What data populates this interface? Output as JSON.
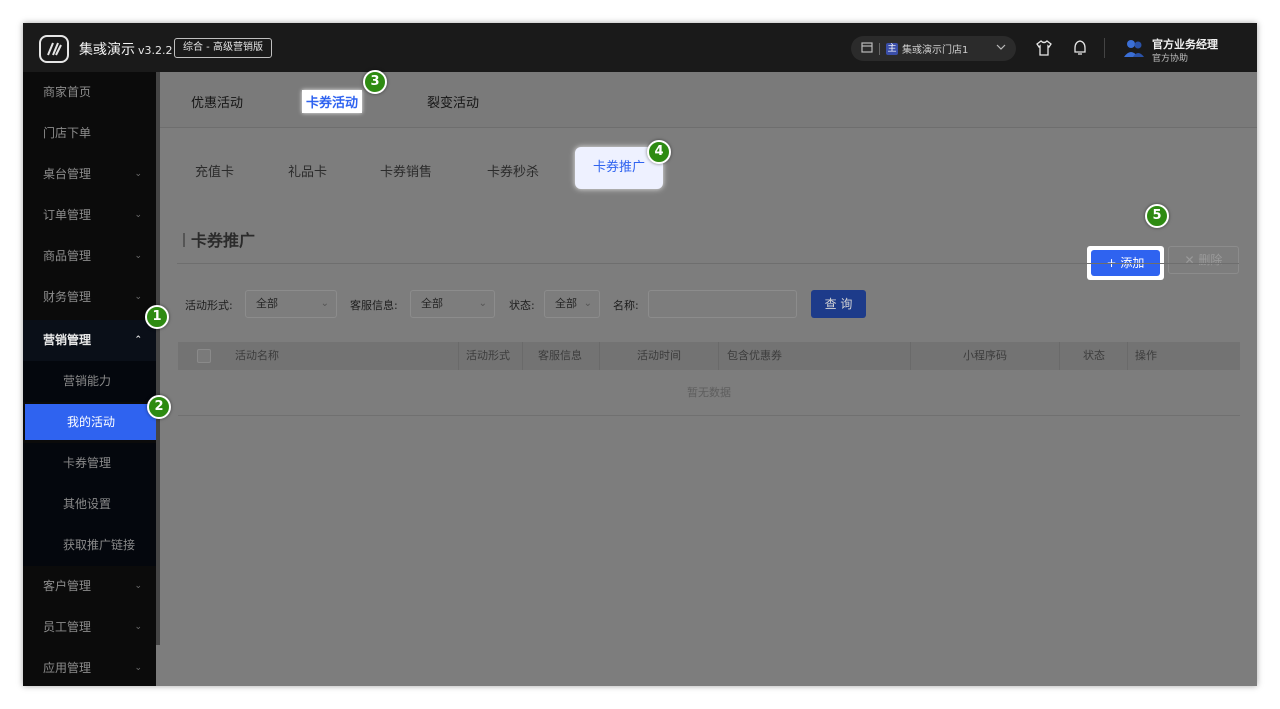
{
  "header": {
    "brand": "集彧演示",
    "version": "v3.2.2",
    "edition": "综合 - 高级营销版",
    "store_tag": "主",
    "store_name": "集彧演示门店1",
    "user_name": "官方业务经理",
    "user_role": "官方协助"
  },
  "sidebar": {
    "items": [
      {
        "label": "商家首页"
      },
      {
        "label": "门店下单"
      },
      {
        "label": "桌台管理"
      },
      {
        "label": "订单管理"
      },
      {
        "label": "商品管理"
      },
      {
        "label": "财务管理"
      },
      {
        "label": "营销管理"
      },
      {
        "label": "客户管理"
      },
      {
        "label": "员工管理"
      },
      {
        "label": "应用管理"
      }
    ],
    "sub_items": [
      {
        "label": "营销能力"
      },
      {
        "label": "我的活动"
      },
      {
        "label": "卡券管理"
      },
      {
        "label": "其他设置"
      },
      {
        "label": "获取推广链接"
      }
    ]
  },
  "tabs_top": [
    "优惠活动",
    "卡券活动",
    "裂变活动"
  ],
  "tabs_sub": [
    "充值卡",
    "礼品卡",
    "卡券销售",
    "卡券秒杀",
    "卡券推广"
  ],
  "section": {
    "title": "卡券推广",
    "add_label": "添加",
    "delete_label": "删除"
  },
  "filters": {
    "activity_form_label": "活动形式:",
    "activity_form_value": "全部",
    "service_label": "客服信息:",
    "service_value": "全部",
    "status_label": "状态:",
    "status_value": "全部",
    "name_label": "名称:",
    "query_label": "查 询"
  },
  "table": {
    "columns": [
      "活动名称",
      "活动形式",
      "客服信息",
      "活动时间",
      "包含优惠券",
      "小程序码",
      "状态",
      "操作"
    ],
    "empty_text": "暂无数据"
  },
  "badges": [
    "1",
    "2",
    "3",
    "4",
    "5"
  ],
  "colors": {
    "accent": "#2f63f0",
    "badge": "#2e8b12",
    "topbar": "#1a1a1a"
  }
}
